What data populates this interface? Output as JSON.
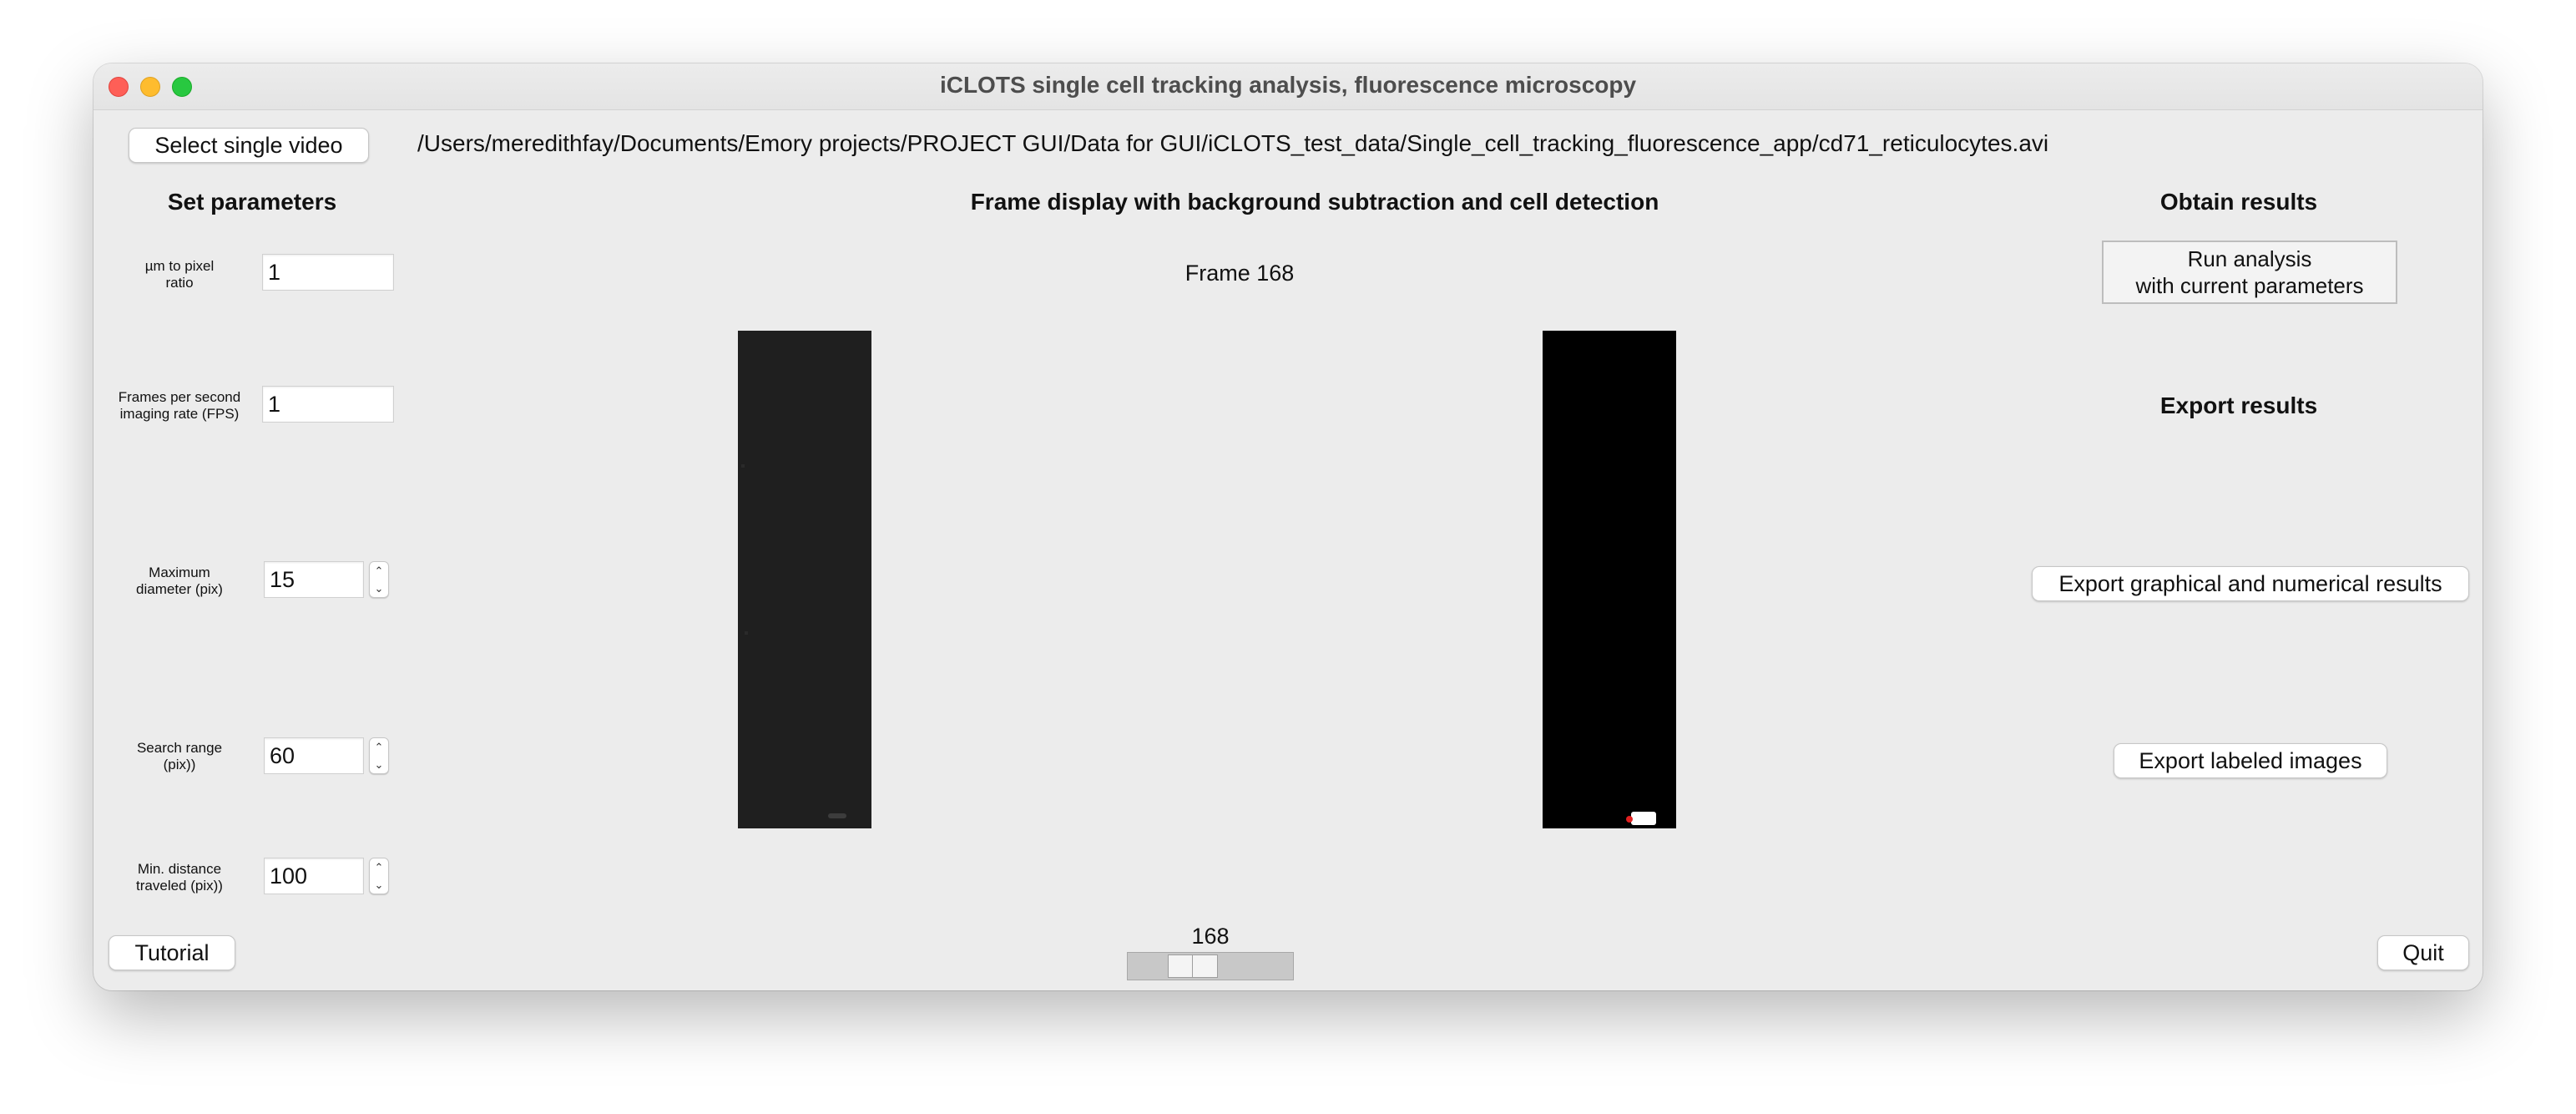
{
  "window": {
    "title": "iCLOTS single cell tracking analysis, fluorescence microscopy"
  },
  "toolbar": {
    "select_video_label": "Select single video",
    "file_path": "/Users/meredithfay/Documents/Emory projects/PROJECT GUI/Data for GUI/iCLOTS_test_data/Single_cell_tracking_fluorescence_app/cd71_reticulocytes.avi"
  },
  "parameters": {
    "heading": "Set parameters",
    "items": [
      {
        "label_line1": "µm to pixel",
        "label_line2": "ratio",
        "value": "1",
        "stepper": false
      },
      {
        "label_line1": "Frames per second",
        "label_line2": "imaging rate (FPS)",
        "value": "1",
        "stepper": false
      },
      {
        "label_line1": "Maximum",
        "label_line2": "diameter (pix)",
        "value": "15",
        "stepper": true
      },
      {
        "label_line1": "Search range",
        "label_line2": "(pix))",
        "value": "60",
        "stepper": true
      },
      {
        "label_line1": "Min. distance",
        "label_line2": "traveled (pix))",
        "value": "100",
        "stepper": true
      }
    ]
  },
  "display": {
    "heading": "Frame display with background subtraction and cell detection",
    "frame_label": "Frame 168",
    "left_panel_color": "#1f1f1f",
    "right_panel_color": "#000000"
  },
  "results": {
    "obtain_heading": "Obtain results",
    "run_line1": "Run analysis",
    "run_line2": "with current parameters",
    "export_heading": "Export results",
    "export_graphical_label": "Export graphical and numerical results",
    "export_images_label": "Export labeled images"
  },
  "footer": {
    "tutorial_label": "Tutorial",
    "quit_label": "Quit",
    "slider_value": "168",
    "slider_fraction": 0.35
  }
}
